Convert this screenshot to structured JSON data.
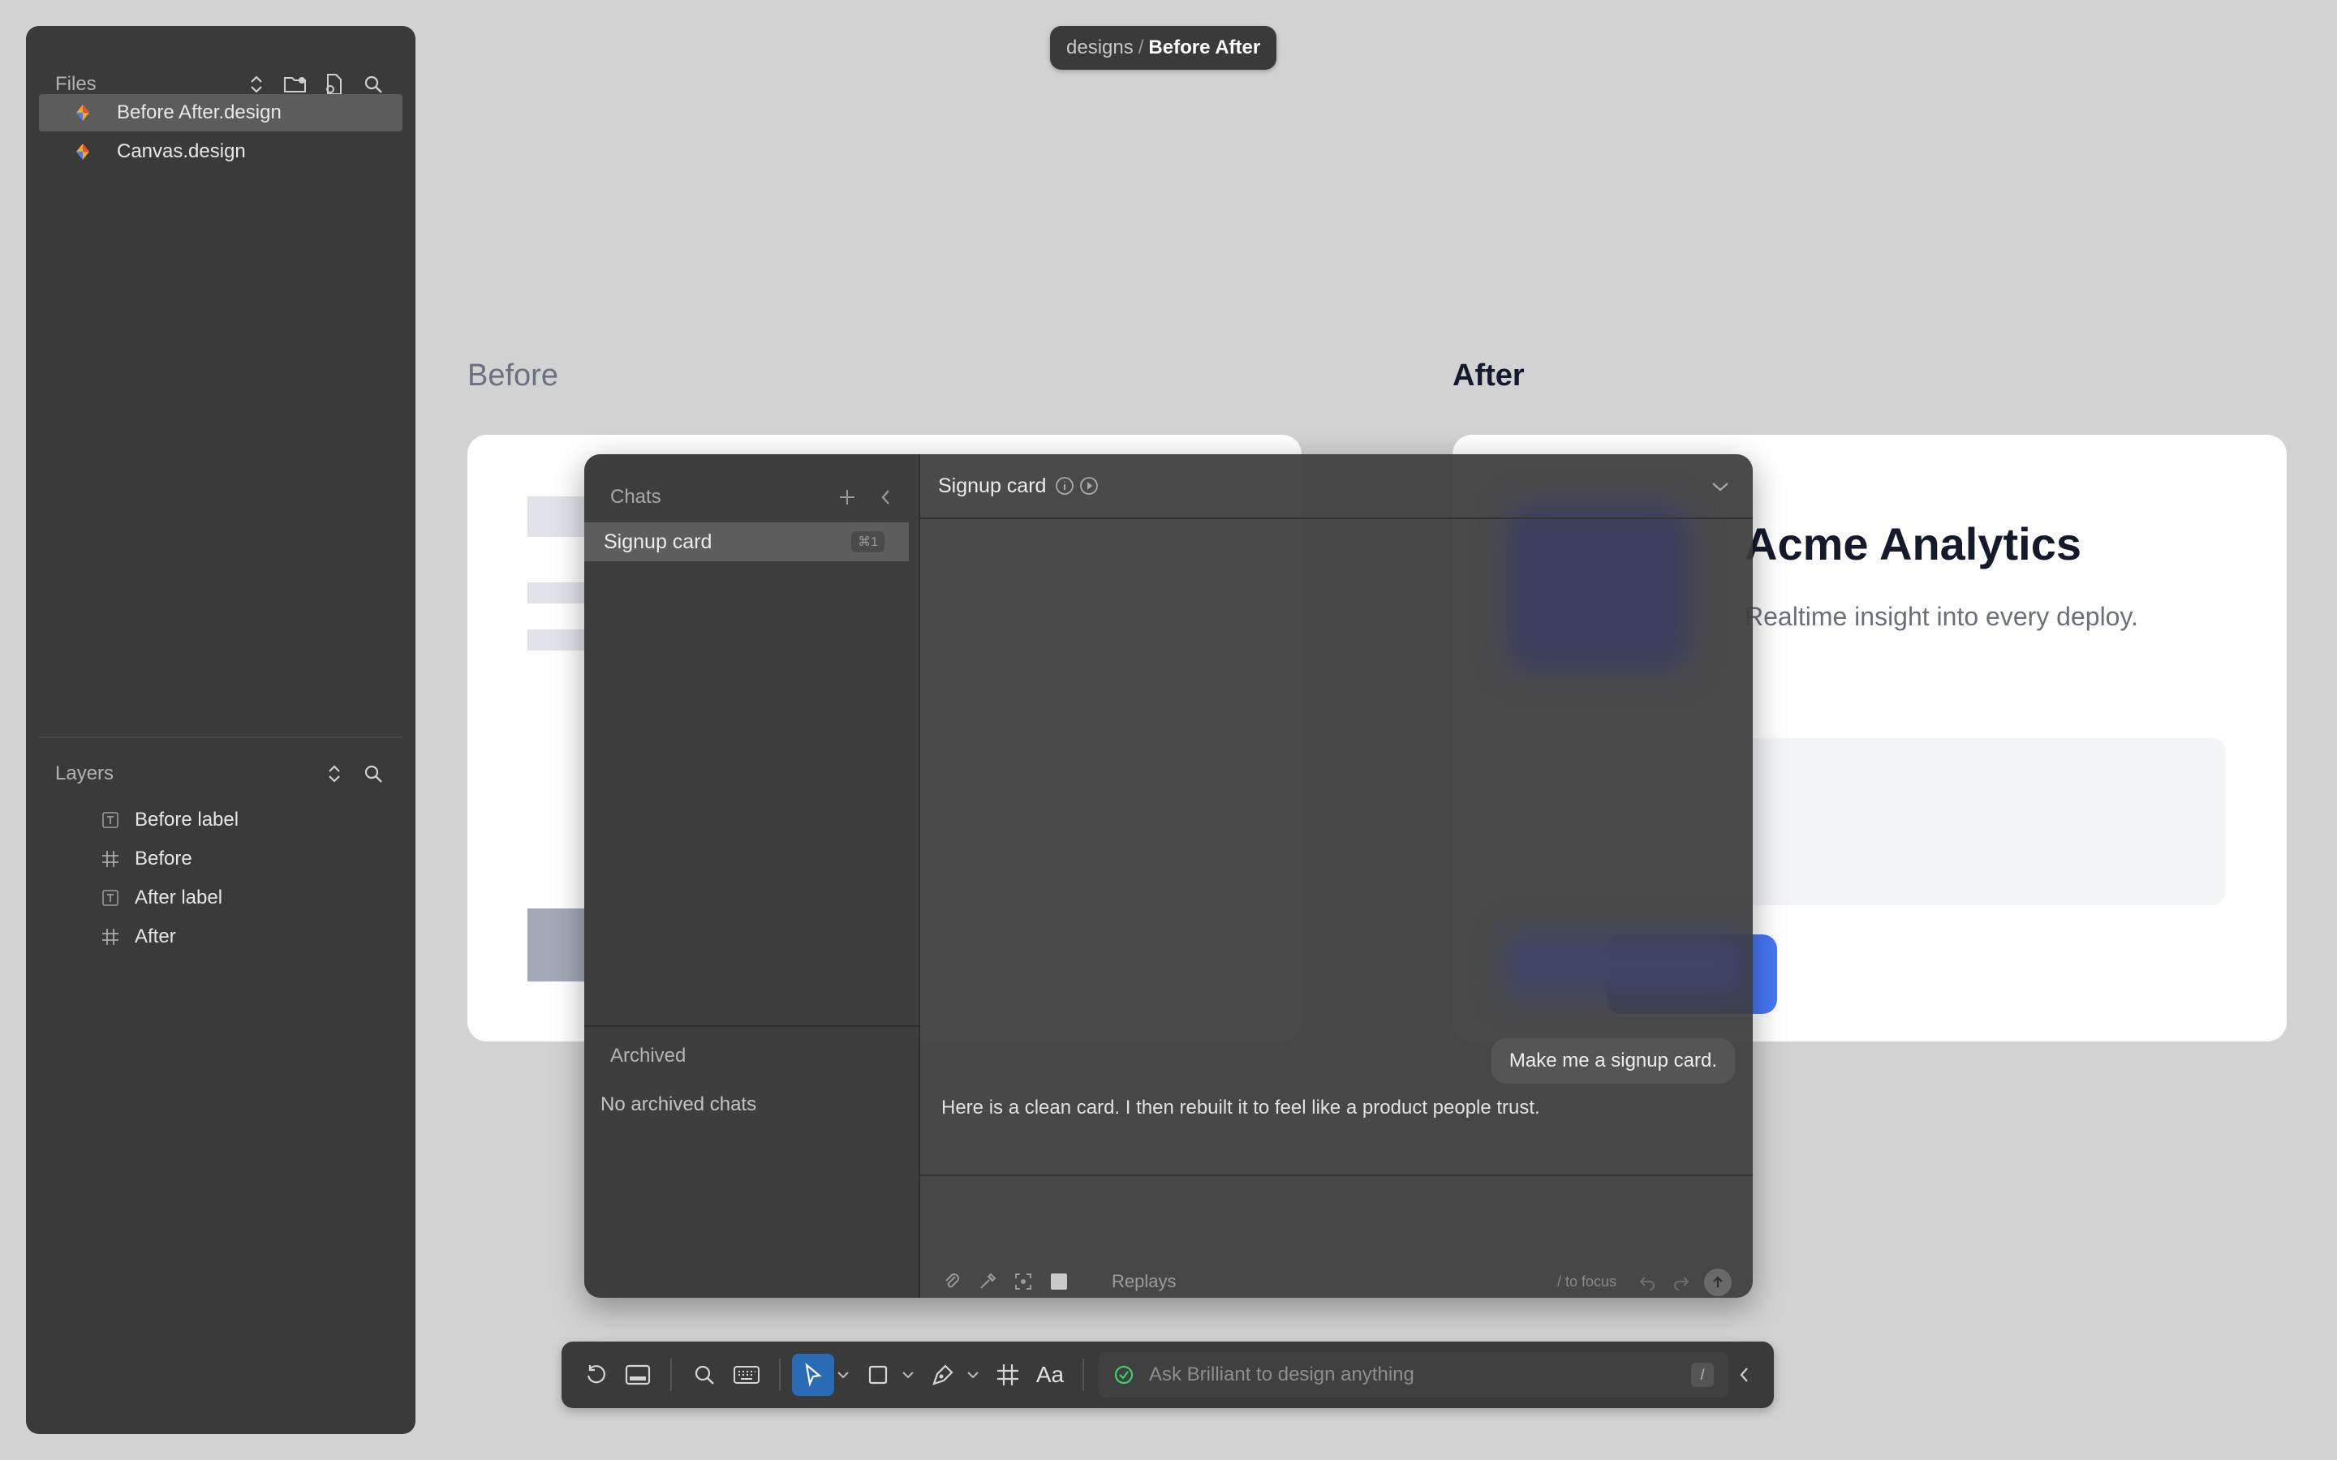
{
  "breadcrumb": {
    "folder": "designs",
    "separator": "/",
    "file": "Before After"
  },
  "files": {
    "title": "Files",
    "items": [
      {
        "label": "Before After.design",
        "selected": true
      },
      {
        "label": "Canvas.design",
        "selected": false
      }
    ]
  },
  "layers": {
    "title": "Layers",
    "items": [
      {
        "label": "Before label",
        "icon": "text-icon"
      },
      {
        "label": "Before",
        "icon": "frame-icon"
      },
      {
        "label": "After label",
        "icon": "text-icon"
      },
      {
        "label": "After",
        "icon": "frame-icon"
      }
    ]
  },
  "canvas": {
    "before_label": "Before",
    "after_label": "After",
    "after_card": {
      "title": "Acme Analytics",
      "subtitle": "Realtime insight into every deploy."
    }
  },
  "chat": {
    "sidebar_title": "Chats",
    "items": [
      {
        "label": "Signup card",
        "shortcut": "⌘1"
      }
    ],
    "archived_title": "Archived",
    "archived_empty": "No archived chats",
    "header_title": "Signup card",
    "messages": {
      "user": "Make me a signup card.",
      "assistant": "Here is a clean card. I then rebuilt it to feel like a product people trust."
    },
    "composer": {
      "replays_label": "Replays",
      "focus_hint": "/ to focus"
    }
  },
  "toolbar": {
    "ask_placeholder": "Ask Brilliant to design anything",
    "slash_key": "/",
    "text_tool_label": "Aa"
  },
  "colors": {
    "accent_active": "#2a6bb5",
    "primary_button": "#4677f5",
    "ok_green": "#3ecf6e"
  }
}
